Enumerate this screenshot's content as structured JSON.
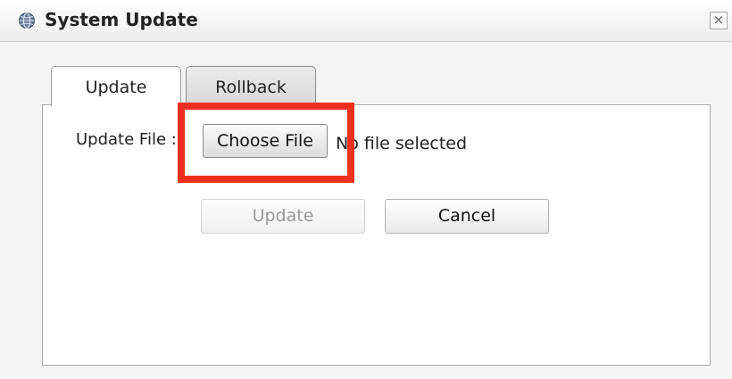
{
  "dialog": {
    "title": "System Update",
    "close_symbol": "×",
    "title_icon": "globe-icon"
  },
  "tabs": [
    {
      "label": "Update",
      "active": true
    },
    {
      "label": "Rollback",
      "active": false
    }
  ],
  "form": {
    "file_label": "Update File :",
    "choose_file_label": "Choose File",
    "file_status": "No file selected"
  },
  "buttons": {
    "update_label": "Update",
    "update_enabled": false,
    "cancel_label": "Cancel"
  },
  "colors": {
    "highlight": "#f0301e"
  }
}
